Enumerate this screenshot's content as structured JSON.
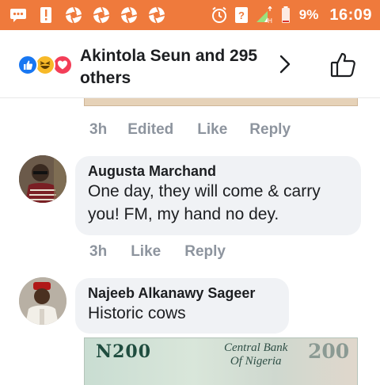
{
  "status_bar": {
    "left_icons": [
      "message-icon",
      "alert-icon",
      "aperture-icon",
      "aperture-icon",
      "aperture-icon",
      "aperture-icon"
    ],
    "battery_percent": "9%",
    "time": "16:09",
    "background": "#ef7a3c"
  },
  "header": {
    "reactions": [
      "like",
      "haha",
      "love"
    ],
    "title": "Akintola Seun and 295 others"
  },
  "previous_comment": {
    "time": "3h",
    "edited": "Edited",
    "like_label": "Like",
    "reply_label": "Reply"
  },
  "comments": [
    {
      "author": "Augusta Marchand",
      "text": "One day, they will come & carry you! FM, my hand no dey.",
      "time": "3h",
      "like_label": "Like",
      "reply_label": "Reply"
    },
    {
      "author": "Najeeb Alkanawy Sageer",
      "text": "Historic cows",
      "attachment": {
        "amount": "N200",
        "bank_line1": "Central Bank",
        "bank_line2": "Of Nigeria",
        "amount_right": "200"
      }
    }
  ],
  "colors": {
    "like_blue": "#1877f2",
    "haha_yellow": "#f7b928",
    "love_red": "#f33e58",
    "meta_gray": "#8d949e"
  }
}
